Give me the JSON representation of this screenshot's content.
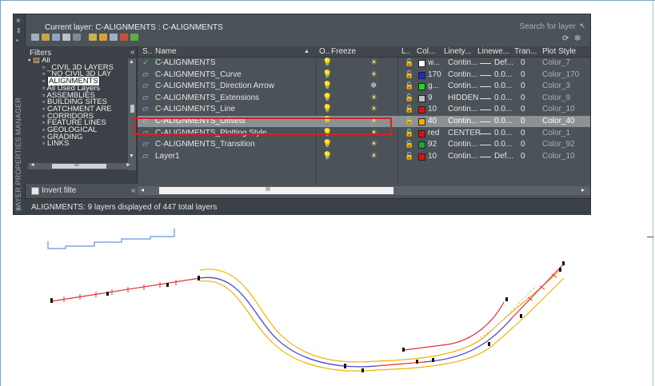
{
  "header": {
    "current_layer": "Current layer: C-ALIGNMENTS : C-ALIGNMENTS",
    "search_placeholder": "Search for layer",
    "side_title": "LAYER PROPERTIES MANAGER"
  },
  "filters": {
    "heading": "Filters",
    "items": [
      "All",
      "_CIVIL 3D LAYERS",
      "_NO CIVIL 3D LAY",
      "ALIGNMENTS",
      "All Used Layers",
      "ASSEMBLIES",
      "BUILDING SITES",
      "CATCHMENT ARE",
      "CORRIDORS",
      "FEATURE LINES",
      "GEOLOGICAL",
      "GRADING",
      "LINKS"
    ],
    "selected": "ALIGNMENTS",
    "invert_label": "Invert filte"
  },
  "columns": {
    "status": "S..",
    "name": "Name",
    "on": "O..",
    "freeze": "Freeze",
    "lock": "L..",
    "color": "Col...",
    "linetype": "Linety...",
    "lineweight": "Linewe...",
    "transparency": "Tran...",
    "plot_style": "Plot Style"
  },
  "layers": [
    {
      "name": "C-ALIGNMENTS",
      "color_name": "w...",
      "color_hex": "#ffffff",
      "linetype": "Contin...",
      "lineweight": "Def...",
      "trans": "0",
      "plot": "Color_7",
      "current": true,
      "frozen": false
    },
    {
      "name": "C-ALIGNMENTS_Curve",
      "color_name": "170",
      "color_hex": "#1a2bd6",
      "linetype": "Contin...",
      "lineweight": "0.0...",
      "trans": "0",
      "plot": "Color_170",
      "current": false,
      "frozen": false
    },
    {
      "name": "C-ALIGNMENTS_Direction Arrow",
      "color_name": "g...",
      "color_hex": "#22d622",
      "linetype": "Contin...",
      "lineweight": "0.0...",
      "trans": "0",
      "plot": "Color_3",
      "current": false,
      "frozen": true
    },
    {
      "name": "C-ALIGNMENTS_Extensions",
      "color_name": "9",
      "color_hex": "#c0c0c0",
      "linetype": "HIDDEN",
      "lineweight": "0.0...",
      "trans": "0",
      "plot": "Color_9",
      "current": false,
      "frozen": false
    },
    {
      "name": "C-ALIGNMENTS_Line",
      "color_name": "10",
      "color_hex": "#e01010",
      "linetype": "Contin...",
      "lineweight": "0.0...",
      "trans": "0",
      "plot": "Color_10",
      "current": false,
      "frozen": false
    },
    {
      "name": "C-ALIGNMENTS_Offsets",
      "color_name": "40",
      "color_hex": "#f2b000",
      "linetype": "Contin...",
      "lineweight": "0.0...",
      "trans": "0",
      "plot": "Color_40",
      "current": false,
      "frozen": false
    },
    {
      "name": "C-ALIGNMENTS_Plotting Style",
      "color_name": "red",
      "color_hex": "#e01010",
      "linetype": "CENTER",
      "lineweight": "0.0...",
      "trans": "0",
      "plot": "Color_1",
      "current": false,
      "frozen": false
    },
    {
      "name": "C-ALIGNMENTS_Transition",
      "color_name": "92",
      "color_hex": "#14a83a",
      "linetype": "Contin...",
      "lineweight": "0.0...",
      "trans": "0",
      "plot": "Color_92",
      "current": false,
      "frozen": false
    },
    {
      "name": "Layer1",
      "color_name": "10",
      "color_hex": "#e01010",
      "linetype": "Contin...",
      "lineweight": "Def...",
      "trans": "0",
      "plot": "Color_10",
      "current": false,
      "frozen": false
    }
  ],
  "highlighted_layer": "C-ALIGNMENTS_Offsets",
  "status_text": "ALIGNMENTS: 9 layers displayed of 447 total layers",
  "scroll_glyph": "III"
}
